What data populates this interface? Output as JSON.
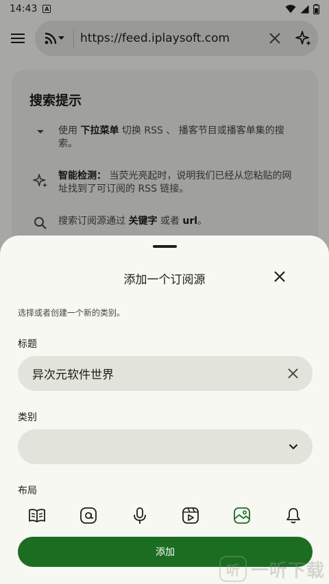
{
  "status_bar": {
    "time": "14:43",
    "badge": "A"
  },
  "top_bar": {
    "url": "https://feed.iplaysoft.com"
  },
  "tips": {
    "title": "搜索提示",
    "dropdown": {
      "pre": "使用",
      "bold": "下拉菜单",
      "post": "切换 RSS 、 播客节目或播客单集的搜索。"
    },
    "smart": {
      "bold": "智能检测：",
      "post": "当荧光亮起时，说明我们已经从您粘贴的网址找到了可订阅的 RSS 链接。"
    },
    "search": {
      "pre": "搜索订阅源通过",
      "bold1": "关键字",
      "mid": "或者",
      "bold2": "url",
      "end": "。"
    }
  },
  "sheet": {
    "title": "添加一个订阅源",
    "hint": "选择或者创建一个新的类别。",
    "title_label": "标题",
    "title_value": "异次元软件世界",
    "category_label": "类别",
    "category_value": "",
    "layout_label": "布局",
    "selected_layout": 4,
    "add_label": "添加"
  },
  "watermark": {
    "text": "一听下载",
    "icon_text": "听"
  },
  "colors": {
    "accent": "#1b6d21",
    "field_bg": "#e2e4dc",
    "sheet_bg": "#f6f8f1"
  },
  "icons": [
    "menu-icon",
    "rss-icon",
    "close-icon",
    "sparkle-icon",
    "chevron-down-icon",
    "search-icon",
    "book-icon",
    "at-icon",
    "microphone-icon",
    "video-icon",
    "image-icon",
    "bell-icon"
  ]
}
